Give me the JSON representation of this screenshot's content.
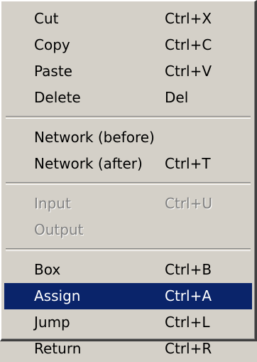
{
  "menu": {
    "groups": [
      {
        "items": [
          {
            "label": "Cut",
            "shortcut": "Ctrl+X"
          },
          {
            "label": "Copy",
            "shortcut": "Ctrl+C"
          },
          {
            "label": "Paste",
            "shortcut": "Ctrl+V"
          },
          {
            "label": "Delete",
            "shortcut": "Del"
          }
        ]
      },
      {
        "items": [
          {
            "label": "Network (before)",
            "shortcut": ""
          },
          {
            "label": "Network (after)",
            "shortcut": "Ctrl+T"
          }
        ]
      },
      {
        "items": [
          {
            "label": "Input",
            "shortcut": "Ctrl+U",
            "state": "disabled"
          },
          {
            "label": "Output",
            "shortcut": "",
            "state": "disabled"
          }
        ]
      },
      {
        "items": [
          {
            "label": "Box",
            "shortcut": "Ctrl+B"
          },
          {
            "label": "Assign",
            "shortcut": "Ctrl+A",
            "state": "highlighted"
          },
          {
            "label": "Jump",
            "shortcut": "Ctrl+L"
          },
          {
            "label": "Return",
            "shortcut": "Ctrl+R"
          }
        ]
      }
    ],
    "colors": {
      "menu_background": "#d4d0c8",
      "highlight_background": "#0a246a",
      "highlight_text": "#ffffff",
      "disabled_text": "#808080"
    }
  }
}
